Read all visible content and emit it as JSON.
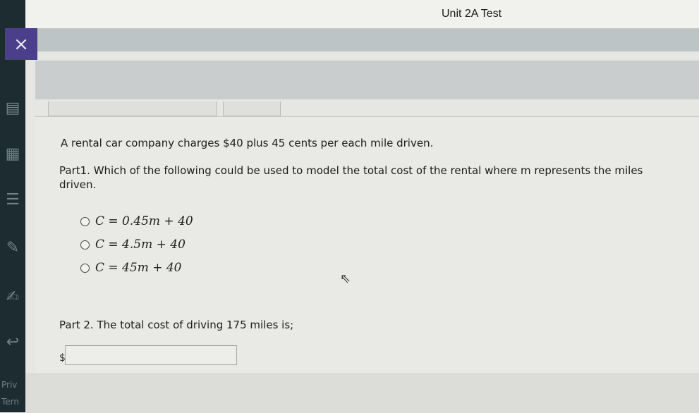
{
  "window": {
    "title": "Unit 2A Test"
  },
  "nav": {
    "close_symbol": "×",
    "footer_links": [
      "Priv",
      "Tern"
    ]
  },
  "question": {
    "intro": "A rental car company charges $40 plus 45 cents per each mile driven.",
    "part1": {
      "prompt": "Part1. Which of the following could be used to model the total cost of the rental where m represents the miles driven.",
      "options": [
        "C = 0.45m + 40",
        "C = 4.5m + 40",
        "C = 45m + 40"
      ]
    },
    "part2": {
      "prompt": "Part 2. The total cost of driving 175 miles is;",
      "currency_symbol": "$",
      "answer_value": ""
    }
  },
  "colors": {
    "rail": "#1d2c30",
    "close_button": "#4b3f8c",
    "background": "#e6e6e2"
  }
}
